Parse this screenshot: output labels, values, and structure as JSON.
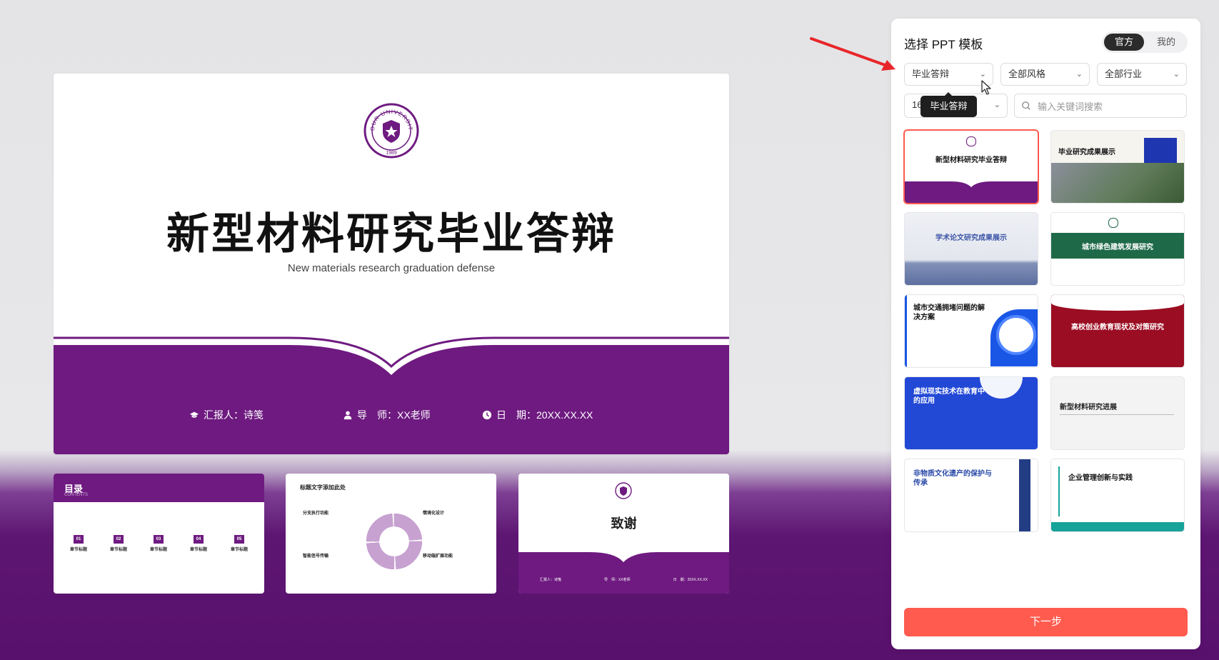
{
  "colors": {
    "brand_purple": "#6e1a80",
    "accent_red": "#ff5b4f",
    "selected_border": "#ff5a4e"
  },
  "main_slide": {
    "seal_text": "YOUR UNIVERSITY",
    "seal_year": "1989",
    "title": "新型材料研究毕业答辩",
    "subtitle": "New materials research graduation defense",
    "reporter": "汇报人：诗笺",
    "advisor": "导　师：XX老师",
    "date": "日　期：20XX.XX.XX"
  },
  "thumbnails": {
    "toc": {
      "title": "目录",
      "subtitle": "CONTENTS",
      "items": [
        {
          "num": "01",
          "label": "章节标题"
        },
        {
          "num": "02",
          "label": "章节标题"
        },
        {
          "num": "03",
          "label": "章节标题"
        },
        {
          "num": "04",
          "label": "章节标题"
        },
        {
          "num": "05",
          "label": "章节标题"
        }
      ]
    },
    "content": {
      "title": "标题文字添加此处",
      "points": [
        "分支执行功能",
        "情境化设计",
        "智能信号传输",
        "移动端扩展功能"
      ]
    },
    "thanks": {
      "title": "致谢",
      "meta": [
        "汇报人：诗笺",
        "导　师：XX老师",
        "日　期：20XX.XX.XX"
      ]
    }
  },
  "panel": {
    "title": "选择 PPT 模板",
    "tabs": {
      "official": "官方",
      "mine": "我的"
    },
    "filters": {
      "category": "毕业答辩",
      "style": "全部风格",
      "industry": "全部行业",
      "ratio": "16"
    },
    "tooltip": "毕业答辩",
    "search_placeholder": "输入关键词搜索",
    "templates": [
      "新型材料研究毕业答辩",
      "毕业研究成果展示",
      "学术论文研究成果展示",
      "城市绿色建筑发展研究",
      "城市交通拥堵问题的解决方案",
      "高校创业教育现状及对策研究",
      "虚拟现实技术在教育中的应用",
      "新型材料研究进展",
      "非物质文化遗产的保护与传承",
      "企业管理创新与实践"
    ],
    "next_button": "下一步"
  },
  "icons": [
    "graduation-cap-icon",
    "user-icon",
    "clock-icon",
    "chevron-down-icon",
    "search-icon",
    "cursor-icon",
    "red-arrow-annotation"
  ]
}
